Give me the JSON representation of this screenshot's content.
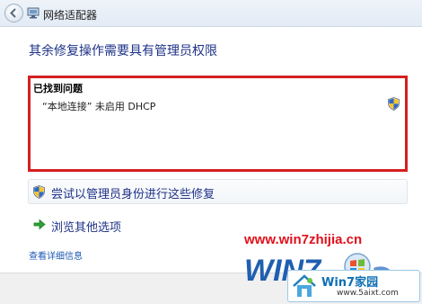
{
  "window": {
    "title": "网络适配器",
    "back_icon": "back-arrow-icon",
    "title_icon": "network-adapter-icon"
  },
  "heading": "其余修复操作需要具有管理员权限",
  "problems": {
    "title": "已找到问题",
    "items": [
      {
        "text": "“本地连接” 未启用 DHCP",
        "icon": "uac-shield-icon"
      }
    ],
    "highlight_color": "#d42020"
  },
  "actions": {
    "admin_fix": {
      "label": "尝试以管理员身份进行这些修复",
      "icon": "uac-shield-icon"
    },
    "other_options": {
      "label": "浏览其他选项",
      "icon": "green-arrow-icon"
    }
  },
  "details_link": "查看详细信息",
  "watermark": {
    "url": "www.win7zhijia.cn",
    "logo_text": "WIN7",
    "site_name": "Win7家园",
    "site_domain": "www.5aixt.com"
  },
  "colors": {
    "link_blue": "#1e3287",
    "watermark_red": "#e0101a"
  }
}
